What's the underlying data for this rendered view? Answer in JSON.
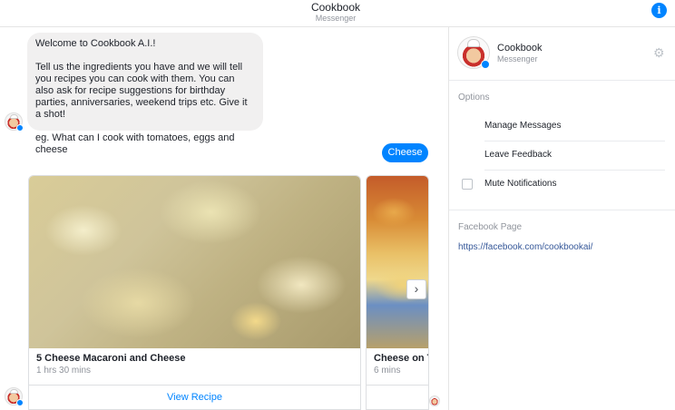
{
  "header": {
    "title": "Cookbook",
    "subtitle": "Messenger",
    "info_icon": "i"
  },
  "chat": {
    "welcome_message": [
      "Welcome to Cookbook A.I.!",
      "Tell us the ingredients you have and we will tell you recipes you can cook with them. You can also ask for recipe suggestions for birthday parties, anniversaries, weekend trips etc. Give it a shot!",
      "eg. What can I cook with tomatoes, eggs and cheese"
    ],
    "user_message": "Cheese",
    "cards": [
      {
        "title": "5 Cheese Macaroni and Cheese",
        "subtitle": "1 hrs 30 mins",
        "button": "View Recipe"
      },
      {
        "title": "Cheese on To",
        "subtitle": "6 mins",
        "button": ""
      }
    ],
    "next_icon": "›"
  },
  "panel": {
    "name": "Cookbook",
    "subtitle": "Messenger",
    "gear_icon": "⚙",
    "options_label": "Options",
    "options": [
      "Manage Messages",
      "Leave Feedback",
      "Mute Notifications"
    ],
    "facebook_label": "Facebook Page",
    "facebook_link": "https://facebook.com/cookbookai/"
  },
  "colors": {
    "accent": "#0084ff",
    "bubble_bg": "#f1f0f0",
    "link": "#365899",
    "muted": "#90949c"
  }
}
